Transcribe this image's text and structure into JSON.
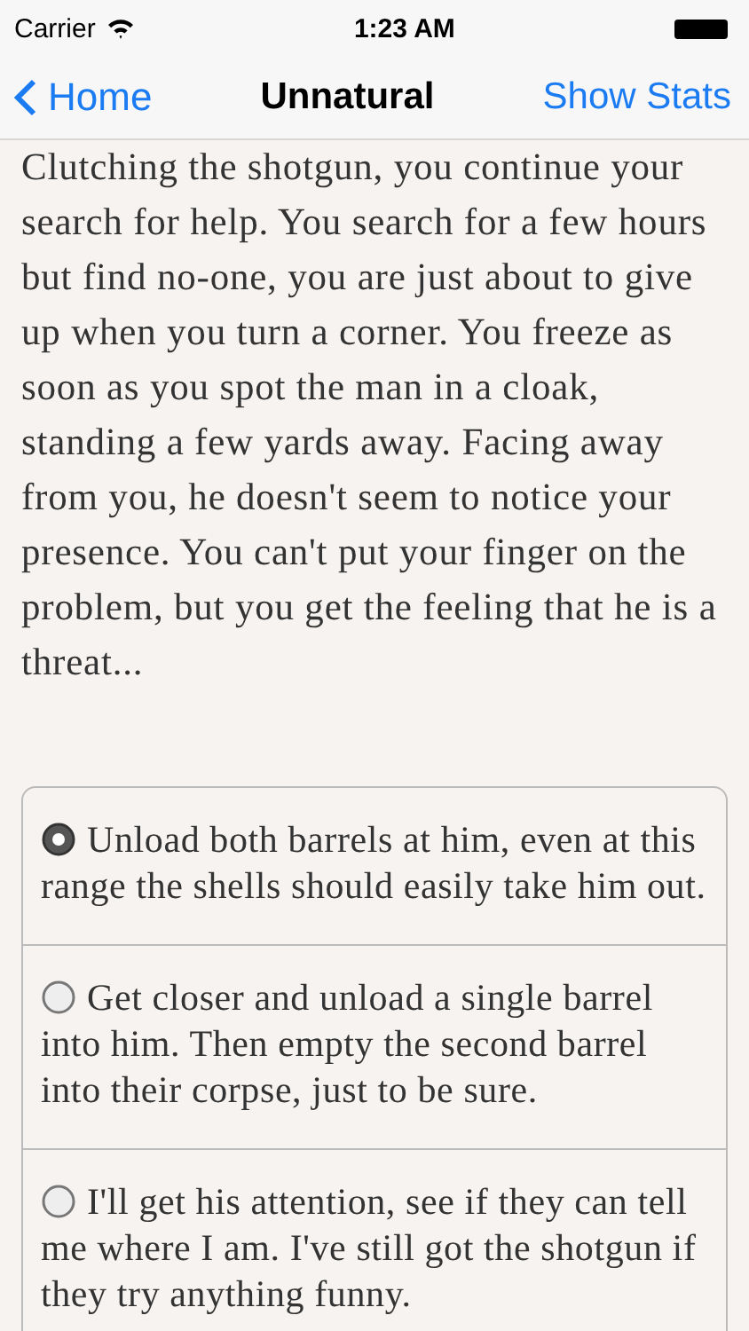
{
  "status_bar": {
    "carrier": "Carrier",
    "time": "1:23 AM"
  },
  "nav": {
    "back": "Home",
    "title": "Unnatural",
    "action": "Show Stats"
  },
  "story": "Clutching the shotgun, you continue your search for help. You search for a few hours but find no-one, you are just about to give up when you turn a corner. You freeze as soon as you spot the man in a cloak, standing a few yards away. Facing away from you, he doesn't seem to notice your presence. You can't put your finger on the problem, but you get the feeling that he is a threat...",
  "choices": [
    {
      "text": "Unload both barrels at him, even at this range the shells should easily take him out.",
      "selected": true
    },
    {
      "text": "Get closer and unload a single barrel into him. Then empty the second barrel into their corpse, just to be sure.",
      "selected": false
    },
    {
      "text": "I'll get his attention, see if they can tell me where I am. I've still got the shotgun if they try anything funny.",
      "selected": false
    }
  ]
}
